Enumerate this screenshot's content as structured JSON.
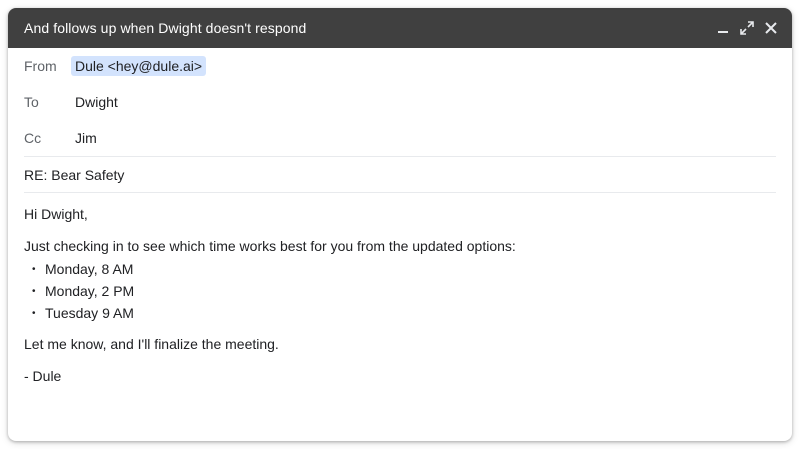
{
  "window": {
    "title": "And follows up when Dwight doesn't respond"
  },
  "fields": {
    "from_label": "From",
    "from_value": "Dule <hey@dule.ai>",
    "to_label": "To",
    "to_value": "Dwight",
    "cc_label": "Cc",
    "cc_value": "Jim",
    "subject": "RE: Bear Safety"
  },
  "body": {
    "greeting": "Hi Dwight,",
    "intro": "Just checking in to see which time works best for you from the updated options:",
    "options": [
      "Monday, 8 AM",
      "Monday, 2 PM",
      "Tuesday 9 AM"
    ],
    "closing": "Let me know, and I'll finalize the meeting.",
    "signature": "- Dule"
  },
  "icons": {
    "minimize": "minimize-icon",
    "expand": "expand-icon",
    "close": "close-icon"
  },
  "colors": {
    "titlebar": "#404040",
    "from_chip": "#d3e3fd"
  }
}
